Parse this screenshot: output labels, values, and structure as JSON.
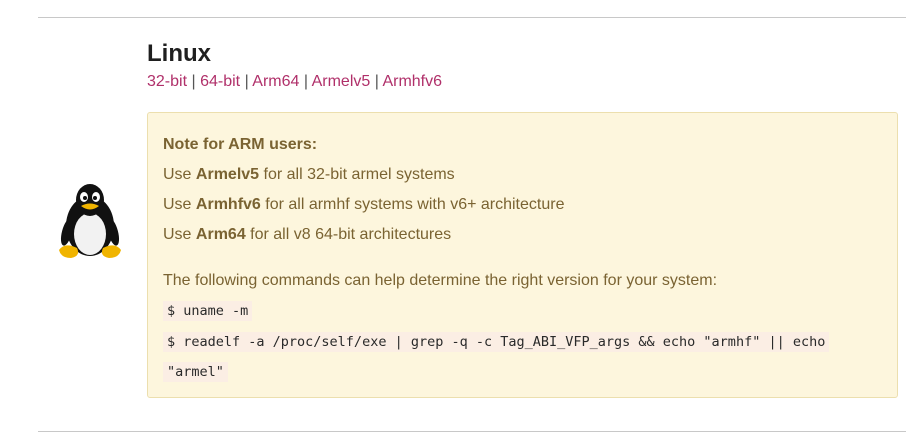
{
  "platform": {
    "title": "Linux",
    "downloads": [
      {
        "label": "32-bit"
      },
      {
        "label": "64-bit"
      },
      {
        "label": "Arm64"
      },
      {
        "label": "Armelv5"
      },
      {
        "label": "Armhfv6"
      }
    ],
    "separator": "|"
  },
  "note": {
    "heading": "Note for ARM users:",
    "rows": [
      {
        "prefix": "Use ",
        "variant": "Armelv5",
        "suffix": " for all 32-bit armel systems"
      },
      {
        "prefix": "Use ",
        "variant": "Armhfv6",
        "suffix": " for all armhf systems with v6+ architecture"
      },
      {
        "prefix": "Use ",
        "variant": "Arm64",
        "suffix": " for all v8 64-bit architectures"
      }
    ],
    "help_text": "The following commands can help determine the right version for your system:",
    "commands": [
      "$ uname -m",
      "$ readelf -a /proc/self/exe | grep -q -c Tag_ABI_VFP_args && echo \"armhf\" || echo",
      "\"armel\""
    ]
  },
  "colors": {
    "link": "#b0306a",
    "note_background": "#fdf6dd",
    "note_text": "#7a6332",
    "code_background": "#fbeee4"
  },
  "icons": {
    "logo": "linux-tux-icon"
  }
}
